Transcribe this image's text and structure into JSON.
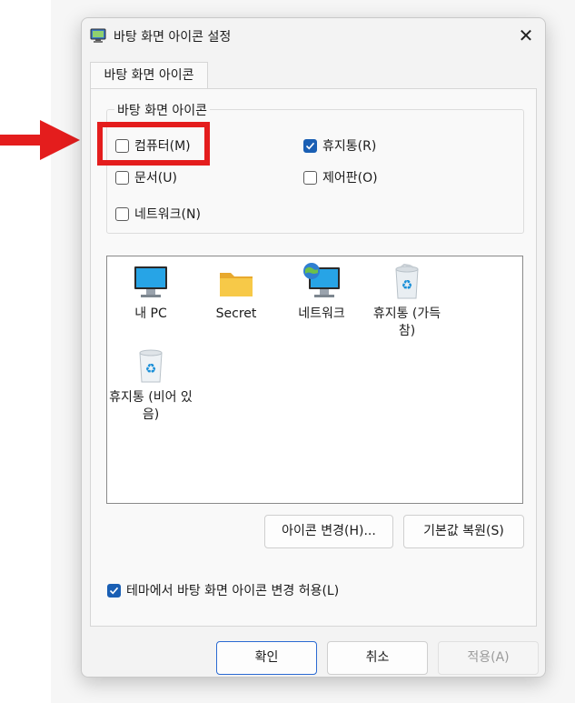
{
  "dialog": {
    "title": "바탕 화면 아이콘 설정",
    "close_glyph": "✕"
  },
  "tab": {
    "label": "바탕 화면 아이콘"
  },
  "group": {
    "legend": "바탕 화면 아이콘",
    "checkboxes": [
      {
        "label": "컴퓨터(M)",
        "checked": false
      },
      {
        "label": "휴지통(R)",
        "checked": true
      },
      {
        "label": "문서(U)",
        "checked": false
      },
      {
        "label": "제어판(O)",
        "checked": false
      },
      {
        "label": "네트워크(N)",
        "checked": false
      }
    ]
  },
  "icons": [
    {
      "label": "내 PC",
      "icon": "monitor-icon"
    },
    {
      "label": "Secret",
      "icon": "folder-icon"
    },
    {
      "label": "네트워크",
      "icon": "network-icon"
    },
    {
      "label": "휴지통 (가득 참)",
      "icon": "recycle-bin-full-icon"
    },
    {
      "label": "휴지통 (비어 있음)",
      "icon": "recycle-bin-empty-icon"
    }
  ],
  "buttons": {
    "change_icon": "아이콘 변경(H)...",
    "restore_default": "기본값 복원(S)",
    "ok": "확인",
    "cancel": "취소",
    "apply": "적용(A)"
  },
  "theme_option": {
    "label": "테마에서 바탕 화면 아이콘 변경 허용(L)",
    "checked": true
  },
  "colors": {
    "accent": "#1a5fb4",
    "highlight": "#e41d1d"
  }
}
